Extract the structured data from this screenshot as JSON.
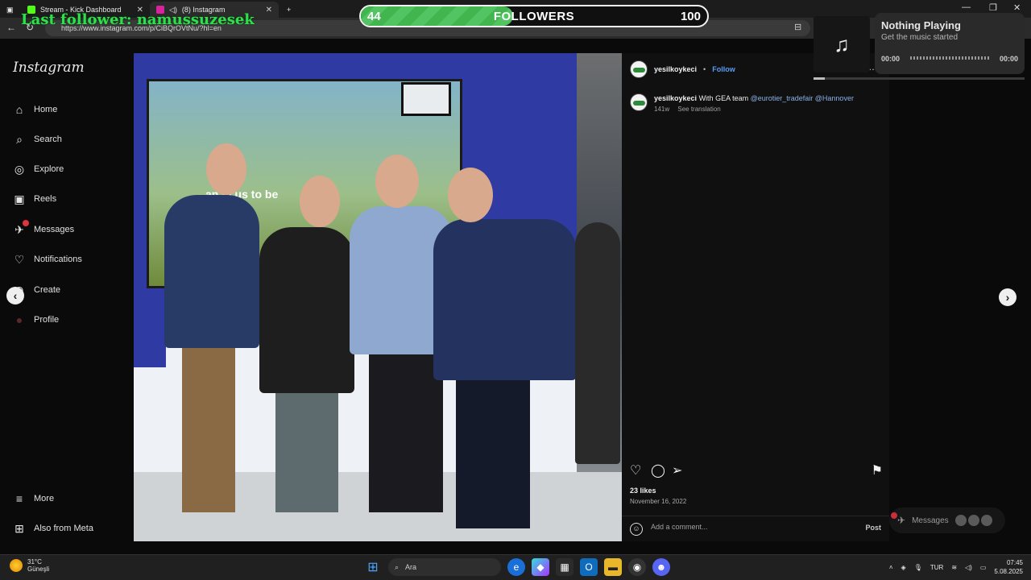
{
  "browser": {
    "tabs": [
      {
        "title": "Stream - Kick Dashboard",
        "favicon_color": "#53fc18"
      },
      {
        "title": "(8) Instagram",
        "favicon_color": "#d6249f"
      }
    ],
    "url": "https://www.instagram.com/p/CiBQrOVtNu/?hl=en",
    "new_tab": "+"
  },
  "overlay": {
    "follower_alert": "Last follower: namussuzesek",
    "goal": {
      "current": "44",
      "title": "FOLLOWERS",
      "max": "100",
      "progress": 0.44
    },
    "music": {
      "title": "Nothing Playing",
      "subtitle": "Get the music started",
      "time_start": "00:00",
      "time_end": "00:00",
      "icon": "music-note-icon"
    }
  },
  "instagram": {
    "logo": "Instagram",
    "nav": [
      {
        "label": "Home",
        "icon": "home-icon",
        "glyph": "⌂"
      },
      {
        "label": "Search",
        "icon": "search-icon",
        "glyph": "⌕"
      },
      {
        "label": "Explore",
        "icon": "compass-icon",
        "glyph": "◎"
      },
      {
        "label": "Reels",
        "icon": "reels-icon",
        "glyph": "▣"
      },
      {
        "label": "Messages",
        "icon": "messenger-icon",
        "glyph": "✈"
      },
      {
        "label": "Notifications",
        "icon": "heart-icon",
        "glyph": "♡"
      },
      {
        "label": "Create",
        "icon": "plus-icon",
        "glyph": "⊕"
      },
      {
        "label": "Profile",
        "icon": "avatar-icon",
        "glyph": "●"
      }
    ],
    "nav_bottom": [
      {
        "label": "More",
        "icon": "menu-icon",
        "glyph": "≡"
      },
      {
        "label": "Also from Meta",
        "icon": "meta-icon",
        "glyph": "⊞"
      }
    ],
    "photo": {
      "screen_text": "an  in us to be"
    },
    "post": {
      "username": "yesilkoykeci",
      "follow": "Follow",
      "caption_text": "With GEA team",
      "mentions": "@eurotier_tradefair @Hannover",
      "age": "141w",
      "see_translation": "See translation",
      "likes": "23 likes",
      "date": "November 16, 2022",
      "comment_placeholder": "Add a comment...",
      "post_button": "Post"
    },
    "messages_pill": "Messages"
  },
  "taskbar": {
    "weather_temp": "31°C",
    "weather_desc": "Güneşli",
    "search": "Ara",
    "lang": "TUR",
    "time": "07:45",
    "date": "5.08.2025"
  }
}
